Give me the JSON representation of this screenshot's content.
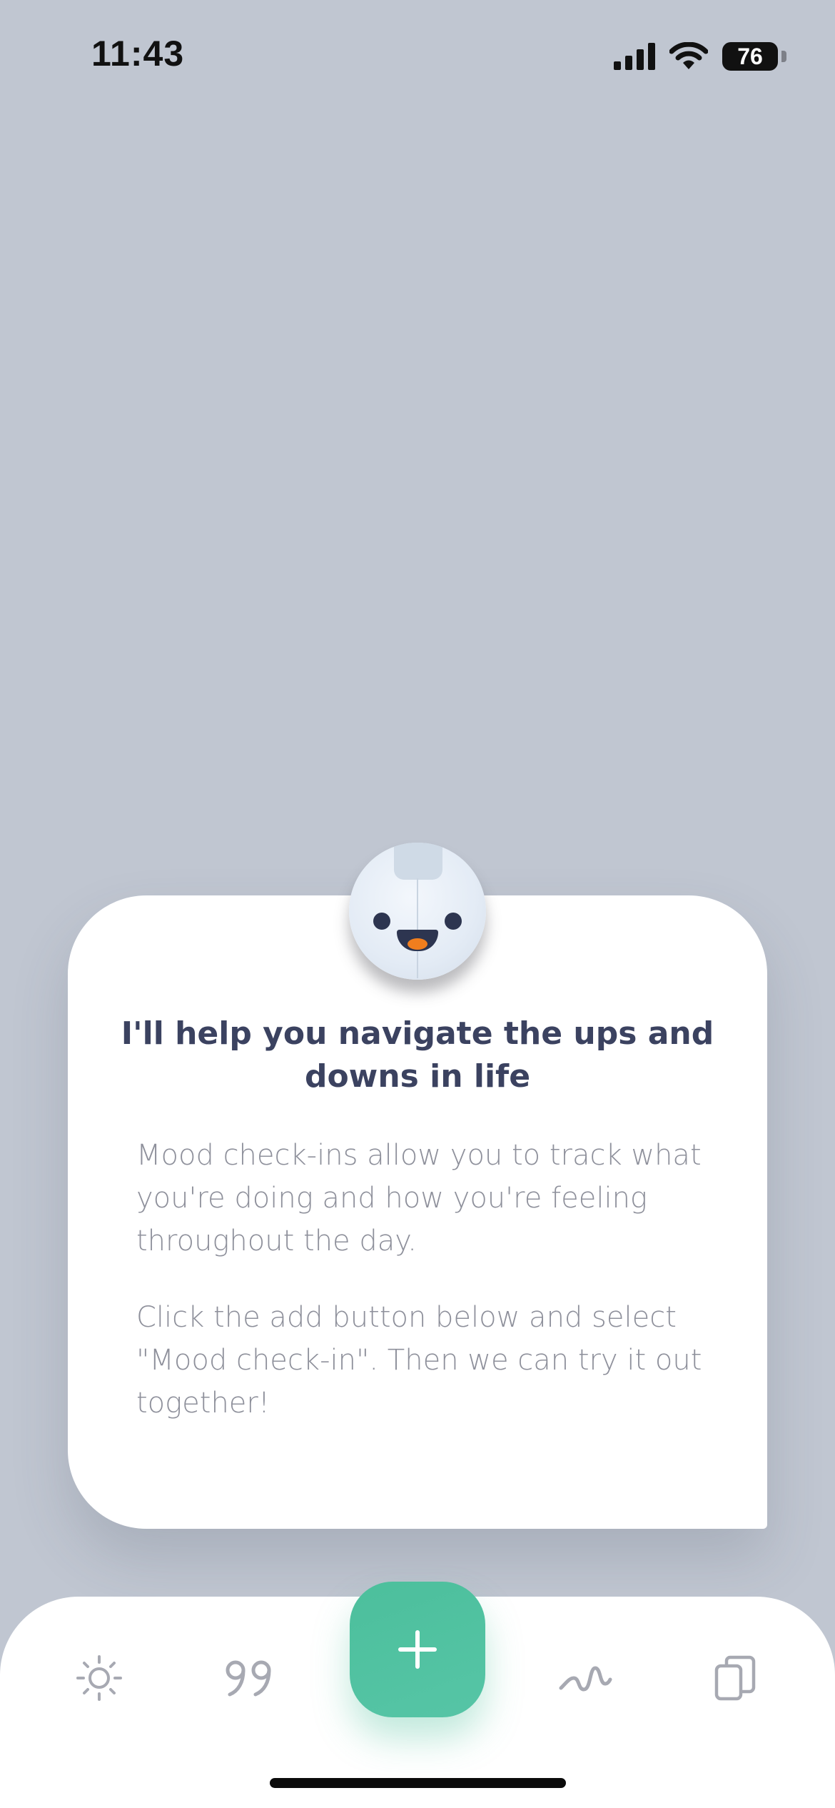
{
  "status_bar": {
    "time": "11:43",
    "battery": "76"
  },
  "card": {
    "title": "I'll help you navigate the ups and downs in life",
    "paragraph_1": "Mood check-ins allow you to track what you're doing and how you're feeling throughout the day.",
    "paragraph_2": "Click the add button below and select \"Mood check-in\". Then we can try it out together!"
  },
  "tab_bar": {
    "items": [
      {
        "icon": "sun-icon"
      },
      {
        "icon": "quote-icon"
      },
      {
        "icon": "plus-icon"
      },
      {
        "icon": "mood-wave-icon"
      },
      {
        "icon": "cards-icon"
      }
    ]
  },
  "colors": {
    "background": "#c0c6d1",
    "card": "#ffffff",
    "title": "#3b4260",
    "body_text": "#8e909b",
    "accent_green": "#4cbf9c",
    "icon_gray": "#a7a9b2"
  }
}
